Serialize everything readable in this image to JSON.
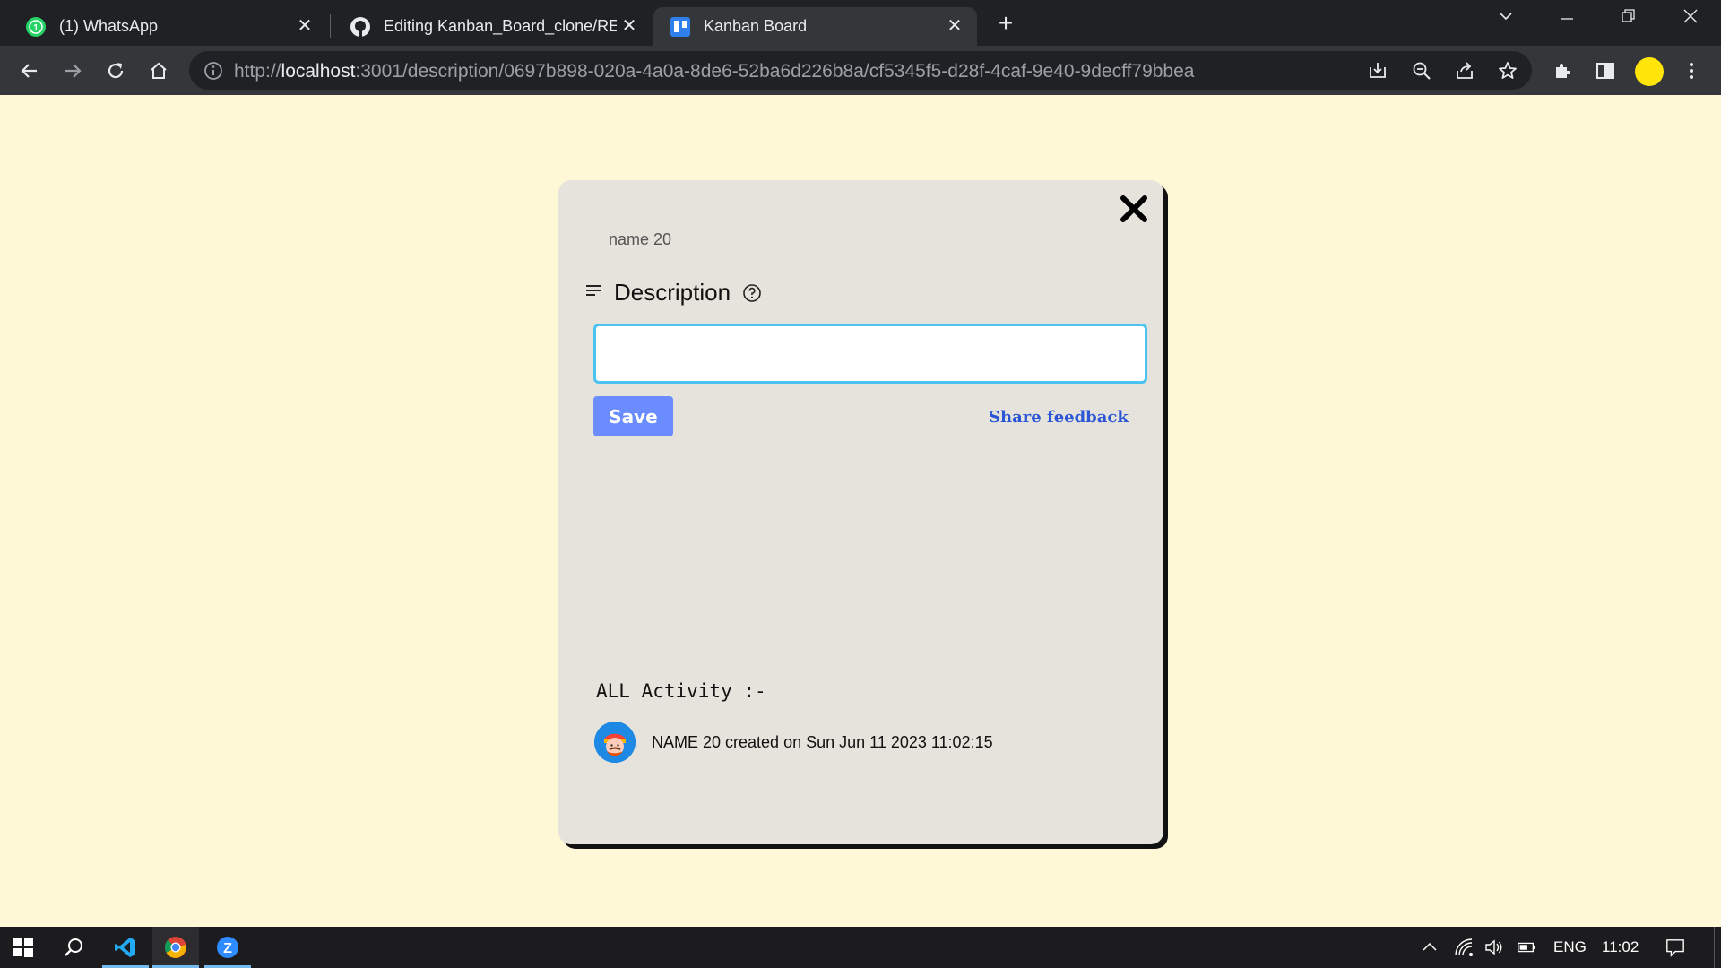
{
  "browser": {
    "tabs": [
      {
        "title": "(1) WhatsApp",
        "icon": "whatsapp-icon",
        "active": false
      },
      {
        "title": "Editing Kanban_Board_clone/REA",
        "icon": "github-icon",
        "active": false
      },
      {
        "title": "Kanban Board",
        "icon": "trello-icon",
        "active": true
      }
    ],
    "url_prefix": "http://",
    "url_host": "localhost",
    "url_path": ":3001/description/0697b898-020a-4a0a-8de6-52ba6d226b8a/cf5345f5-d28f-4caf-9e40-9decff79bbea"
  },
  "modal": {
    "card_name": "name 20",
    "description_title": "Description",
    "description_value": "",
    "save_label": "Save",
    "share_feedback_label": "Share feedback",
    "activity_title": "ALL Activity :-",
    "activities": [
      {
        "text": "NAME 20 created on Sun Jun 11 2023 11:02:15"
      }
    ]
  },
  "taskbar": {
    "language": "ENG",
    "time": "11:02"
  },
  "colors": {
    "page_bg": "#fff8d7",
    "modal_bg": "#e5e3db",
    "save_button": "#6b8cff",
    "link": "#2b57d6",
    "input_border": "#4bc3f1",
    "profile_avatar": "#ffe50a"
  }
}
